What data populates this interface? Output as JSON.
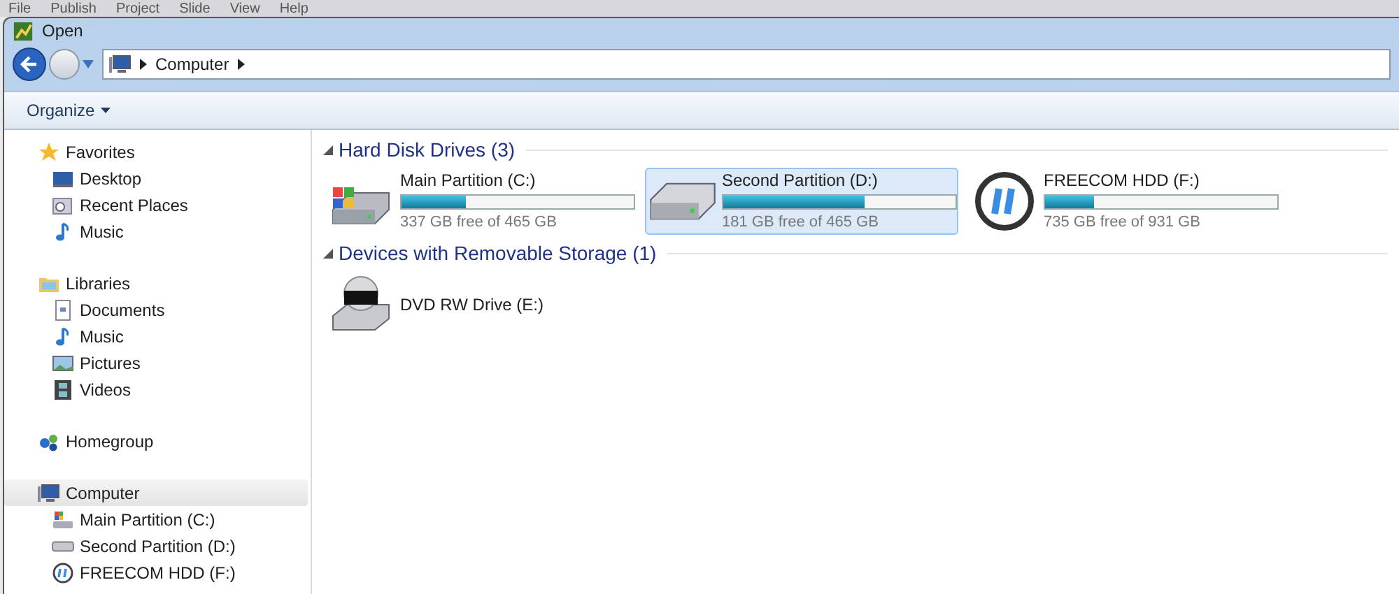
{
  "menu_bar": [
    "File",
    "Publish",
    "Project",
    "Slide",
    "View",
    "Help"
  ],
  "window": {
    "title": "Open"
  },
  "address_bar": {
    "path": [
      "Computer"
    ]
  },
  "toolbar": {
    "organize": "Organize"
  },
  "sidebar": {
    "groups": [
      {
        "label": "Favorites",
        "kind": "star",
        "selected": false,
        "children": [
          {
            "label": "Desktop",
            "kind": "desktop",
            "selected": false
          },
          {
            "label": "Recent Places",
            "kind": "recent",
            "selected": false
          },
          {
            "label": "Music",
            "kind": "music",
            "selected": false
          }
        ]
      },
      {
        "label": "Libraries",
        "kind": "library",
        "selected": false,
        "children": [
          {
            "label": "Documents",
            "kind": "document",
            "selected": false
          },
          {
            "label": "Music",
            "kind": "music",
            "selected": false
          },
          {
            "label": "Pictures",
            "kind": "picture",
            "selected": false
          },
          {
            "label": "Videos",
            "kind": "video",
            "selected": false
          }
        ]
      },
      {
        "label": "Homegroup",
        "kind": "homegroup",
        "selected": false
      },
      {
        "label": "Computer",
        "kind": "computer",
        "selected": true,
        "children": [
          {
            "label": "Main Partition (C:)",
            "kind": "system",
            "selected": false
          },
          {
            "label": "Second Partition (D:)",
            "kind": "disk",
            "selected": false
          },
          {
            "label": "FREECOM HDD (F:)",
            "kind": "freecom",
            "selected": false
          }
        ]
      }
    ]
  },
  "sections": [
    {
      "title": "Hard Disk Drives (3)",
      "expanded": true,
      "items": [
        {
          "name": "Main Partition (C:)",
          "kind": "system",
          "level": 0.275,
          "reading": "337 GB free of 465 GB",
          "selected": false
        },
        {
          "name": "Second Partition (D:)",
          "kind": "disk",
          "level": 0.61,
          "reading": "181 GB free of 465 GB",
          "selected": true
        },
        {
          "name": "FREECOM HDD (F:)",
          "kind": "freecom",
          "level": 0.21,
          "reading": "735 GB free of 931 GB",
          "selected": false
        }
      ]
    },
    {
      "title": "Devices with Removable Storage (1)",
      "expanded": true,
      "items": [
        {
          "name": "DVD RW Drive (E:)",
          "kind": "dvd",
          "selected": false
        }
      ]
    }
  ]
}
